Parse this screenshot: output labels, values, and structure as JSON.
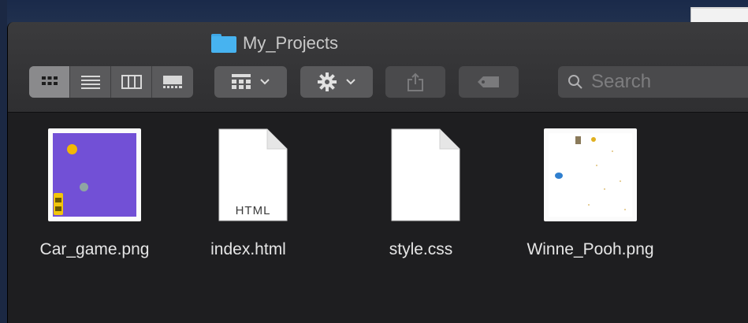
{
  "window": {
    "title": "My_Projects"
  },
  "toolbar": {
    "view_modes": [
      {
        "name": "icon-view",
        "icon": "grid-icon",
        "active": true
      },
      {
        "name": "list-view",
        "icon": "list-icon",
        "active": false
      },
      {
        "name": "column-view",
        "icon": "columns-icon",
        "active": false
      },
      {
        "name": "gallery-view",
        "icon": "gallery-icon",
        "active": false
      }
    ],
    "group_icon": "group-by-icon",
    "action_icon": "gear-icon",
    "share_icon": "share-icon",
    "tag_icon": "tag-icon",
    "search": {
      "placeholder": "Search",
      "value": "",
      "icon": "search-icon"
    }
  },
  "files": [
    {
      "name": "Car_game.png",
      "kind": "image"
    },
    {
      "name": "index.html",
      "kind": "document",
      "badge": "HTML"
    },
    {
      "name": "style.css",
      "kind": "document",
      "badge": ""
    },
    {
      "name": "Winne_Pooh.png",
      "kind": "image"
    }
  ],
  "colors": {
    "folder": "#47b3f0",
    "car_game_bg": "#7250d6",
    "window_bg": "#1e1e20",
    "toolbar_bg": "#3b3b3d"
  }
}
